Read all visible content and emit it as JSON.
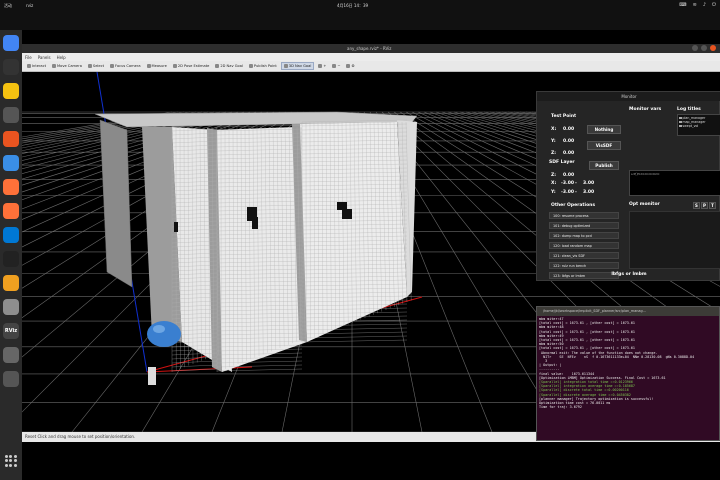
{
  "topbar": {
    "activities": "活动",
    "app": "rviz",
    "clock": "4月16日 14：39",
    "tray": [
      "zh",
      "wifi",
      "vol",
      "pwr"
    ]
  },
  "dock": {
    "apps": [
      {
        "name": "chrome-icon",
        "color": "#4285f4"
      },
      {
        "name": "terminal-icon",
        "color": "#333333"
      },
      {
        "name": "rhythmbox-icon",
        "color": "#f5c211"
      },
      {
        "name": "files-icon",
        "color": "#555555"
      },
      {
        "name": "software-icon",
        "color": "#e95420"
      },
      {
        "name": "help-icon",
        "color": "#3a8ee6"
      },
      {
        "name": "firefox-icon",
        "color": "#ff7139"
      },
      {
        "name": "firefox2-icon",
        "color": "#ff7139"
      },
      {
        "name": "vscode-icon",
        "color": "#0078d4"
      },
      {
        "name": "terminal2-icon",
        "color": "#222222"
      },
      {
        "name": "gzclient-icon",
        "color": "#f0a020"
      },
      {
        "name": "settings-icon",
        "color": "#8e8e8e"
      },
      {
        "name": "rviz-icon",
        "color": "#444444"
      },
      {
        "name": "trash-icon",
        "color": "#666666"
      },
      {
        "name": "files2-icon",
        "color": "#555555"
      }
    ],
    "rviz_label": "RViz"
  },
  "window": {
    "title": "any_shape.rviz* - RViz",
    "menu": [
      "File",
      "Panels",
      "Help"
    ],
    "toolbar": [
      {
        "label": "Interact",
        "icon": "hand-icon",
        "selected": false
      },
      {
        "label": "Move Camera",
        "icon": "camera-icon",
        "selected": false
      },
      {
        "label": "Select",
        "icon": "select-icon",
        "selected": false
      },
      {
        "label": "Focus Camera",
        "icon": "focus-icon",
        "selected": false
      },
      {
        "label": "Measure",
        "icon": "measure-icon",
        "selected": false
      },
      {
        "label": "2D Pose Estimate",
        "icon": "pose-icon",
        "selected": false
      },
      {
        "label": "2D Nav Goal",
        "icon": "goal-icon",
        "selected": false
      },
      {
        "label": "Publish Point",
        "icon": "point-icon",
        "selected": false
      },
      {
        "label": "3D Nav Goal",
        "icon": "goal3d-icon",
        "selected": true
      },
      {
        "label": "+",
        "icon": "add-icon",
        "selected": false
      },
      {
        "label": "−",
        "icon": "remove-icon",
        "selected": false
      },
      {
        "label": "⚙",
        "icon": "gear-icon",
        "selected": false
      }
    ],
    "status": "Reset   Click and drag mouse to set position/orientation."
  },
  "monitor": {
    "title": "Monitor",
    "test_point": {
      "title": "Test Point",
      "x_label": "X:",
      "x_value": "0.00",
      "y_label": "Y:",
      "y_value": "0.00",
      "z_label": "Z:",
      "z_value": "0.00",
      "btn_nothing": "Nothing",
      "btn_vissdf": "VisSDF"
    },
    "sdf_layer": {
      "title": "SDF Layer",
      "z_label": "Z:",
      "z_value": "0.00",
      "x_label": "X:",
      "x_from": "-3.00",
      "x_sep": "-",
      "x_to": "3.00",
      "y_label": "Y:",
      "y_from": "-3.00",
      "y_sep": "-",
      "y_to": "3.00",
      "btn_publish": "Publish"
    },
    "other_ops": {
      "title": "Other Operations",
      "items": [
        "100: resume process",
        "101: debug optimized",
        "102: dump map to pcd",
        "120: load random map",
        "121: clean_vis SDF",
        "122: rulz run bench",
        "123: lbfgs or lmbm"
      ]
    },
    "monitor_vars": {
      "title": "Monitor vars"
    },
    "log_titles": {
      "title": "Log titles",
      "items": [
        "plan_manager",
        "map_manager",
        "swept_vol"
      ]
    },
    "monitor_text": "sdf\u0000f0d0d0d0d0d0",
    "opt_monitor": {
      "title": "Opt monitor",
      "buttons": [
        "S",
        "P",
        "T"
      ]
    },
    "footer": "lbfgs or lmbm"
  },
  "terminal": {
    "title": "/home/jkl/workspace/implicit_SDF_planner/src/plan_manag...",
    "lines": [
      {
        "t": "mbm miter:47",
        "c": ""
      },
      {
        "t": "[total cost] = 1673.61 , [other cost] = 1673.61",
        "c": ""
      },
      {
        "t": "mbm miter:48",
        "c": ""
      },
      {
        "t": "[total cost] = 1673.61 , [other cost] = 1673.61",
        "c": ""
      },
      {
        "t": "mbm miter:49",
        "c": ""
      },
      {
        "t": "[total cost] = 1673.61 , [other cost] = 1673.61",
        "c": ""
      },
      {
        "t": "mbm miter:50",
        "c": ""
      },
      {
        "t": "[total cost] = 1673.61 , [other cost] = 1673.61",
        "c": ""
      },
      {
        "t": " Abnormal exit: The value of the function does not change.",
        "c": ""
      },
      {
        "t": "  NITr    SE  NFEv    nS  f 0.1673611133e+04  NNe 0.28130-08  gNs 0.3088D-04",
        "c": ""
      },
      {
        "t": "   3",
        "c": ""
      },
      {
        "t": "| Output: |",
        "c": ""
      },
      {
        "t": "----------",
        "c": ""
      },
      {
        "t": "final value:    1673.611344",
        "c": ""
      },
      {
        "t": "[Optimization LMBM] Optimization Success. Final Cost = 1673.61",
        "c": ""
      },
      {
        "t": "[Sparallel] integration total time =:0.0123966",
        "c": "g"
      },
      {
        "t": "[Sparallel] integration average time =:0.185687",
        "c": "g"
      },
      {
        "t": "[Sparallel] discrete total time =:0.00200116",
        "c": "g"
      },
      {
        "t": "[Sparallel] discrete average time =:0.0450382",
        "c": "g"
      },
      {
        "t": "[planner manager] Trajectory optimization is successful!",
        "c": ""
      },
      {
        "t": "Optimization time cost = 76.0011 ms",
        "c": ""
      },
      {
        "t": "Time for traj: 3.6792",
        "c": ""
      },
      {
        "t": "",
        "c": ""
      }
    ]
  },
  "colors": {
    "grid": "#6a6a6a",
    "wall": "#e8e8e8",
    "wall_shade": "#9a9a9a",
    "robot": "#3a7fd0",
    "axis_red": "#d01010",
    "axis_blue": "#1030d0"
  }
}
